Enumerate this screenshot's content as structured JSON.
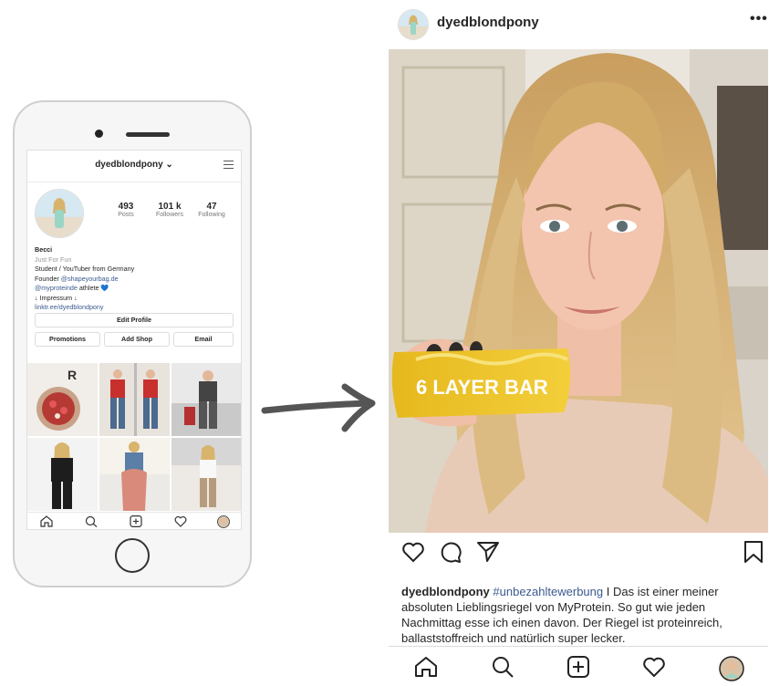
{
  "phone_profile": {
    "username": "dyedblondpony ⌄",
    "stats": [
      {
        "value": "493",
        "label": "Posts"
      },
      {
        "value": "101 k",
        "label": "Followers"
      },
      {
        "value": "47",
        "label": "Following"
      }
    ],
    "bio": {
      "name": "Becci",
      "tagline": "Just For Fun",
      "line1": "Student / YouTuber from Germany",
      "line2_prefix": "Founder ",
      "line2_link": "@shapeyourbag.de",
      "line3_link": "@myproteinde",
      "line3_suffix": " athlete 💙",
      "line4": "↓ Impressum ↓",
      "line5_link": "linktr.ee/dyedblondpony"
    },
    "buttons": {
      "edit_profile": "Edit Profile",
      "promotions": "Promotions",
      "add_shop": "Add Shop",
      "email": "Email"
    }
  },
  "post": {
    "username": "dyedblondpony",
    "more": "•••",
    "photo_text": "6 LAYER BAR",
    "caption_user": "dyedblondpony",
    "caption_tag": "#unbezahltewerbung",
    "caption_text": " I Das ist einer meiner absoluten Lieblingsriegel von MyProtein. So gut wie jeden Nachmittag esse ich einen davon. Der Riegel ist proteinreich, ballaststoffreich und natürlich super lecker."
  },
  "icons": [
    "home-icon",
    "search-icon",
    "add-post-icon",
    "heart-icon",
    "profile-avatar-icon",
    "comment-icon",
    "share-icon",
    "bookmark-icon",
    "hamburger-menu-icon"
  ]
}
